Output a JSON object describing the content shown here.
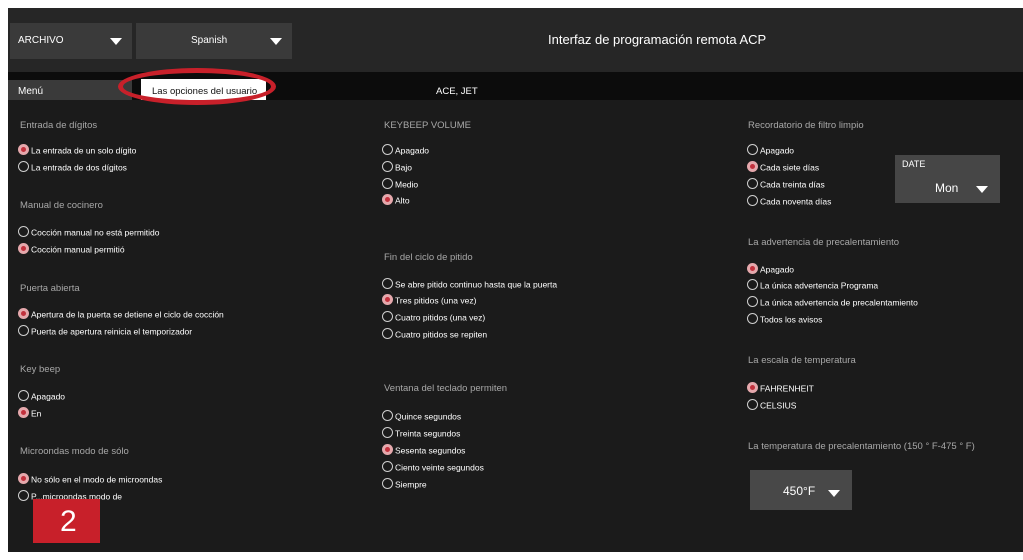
{
  "header": {
    "file_menu": "ARCHIVO",
    "language": "Spanish",
    "title": "Interfaz de programación remota ACP"
  },
  "tabs": {
    "menu": "Menú",
    "user_options": "Las opciones del usuario",
    "models": "ACE, JET"
  },
  "left": {
    "digit_entry": {
      "title": "Entrada de dígitos",
      "options": [
        "La entrada de un solo dígito",
        "La entrada de dos dígitos"
      ]
    },
    "manual_cook": {
      "title": "Manual de cocinero",
      "options": [
        "Cocción manual no está permitido",
        "Cocción manual permitió"
      ]
    },
    "door_open": {
      "title": "Puerta abierta",
      "options": [
        "Apertura de la puerta se detiene el ciclo de cocción",
        "Puerta de apertura reinicia el temporizador"
      ]
    },
    "key_beep": {
      "title": "Key beep",
      "options": [
        "Apagado",
        "En"
      ]
    },
    "micro_only": {
      "title": "Microondas modo de sólo",
      "options": [
        "No sólo en el modo de microondas",
        "P...microondas modo de"
      ]
    }
  },
  "middle": {
    "keybeep_volume": {
      "title": "KEYBEEP VOLUME",
      "options": [
        "Apagado",
        "Bajo",
        "Medio",
        "Alto"
      ]
    },
    "end_cycle": {
      "title": "Fin del ciclo de pitido",
      "options": [
        "Se abre pitido continuo hasta que la puerta",
        "Tres pitidos (una vez)",
        "Cuatro pitidos (una vez)",
        "Cuatro pitidos se repiten"
      ]
    },
    "keypad_window": {
      "title": "Ventana del teclado permiten",
      "options": [
        "Quince segundos",
        "Treinta segundos",
        "Sesenta segundos",
        "Ciento veinte segundos",
        "Siempre"
      ]
    }
  },
  "right": {
    "filter_reminder": {
      "title": "Recordatorio de filtro limpio",
      "options": [
        "Apagado",
        "Cada siete días",
        "Cada treinta días",
        "Cada noventa días"
      ]
    },
    "date": {
      "label": "DATE",
      "value": "Mon"
    },
    "preheat_warning": {
      "title": "La advertencia de precalentamiento",
      "options": [
        "Apagado",
        "La única advertencia Programa",
        "La única advertencia de precalentamiento",
        "Todos los avisos"
      ]
    },
    "temp_scale": {
      "title": "La escala de temperatura",
      "options": [
        "FAHRENHEIT",
        "CELSIUS"
      ]
    },
    "preheat_temp": {
      "title": "La temperatura de precalentamiento (150 ° F-475 ° F)",
      "value": "450°F"
    }
  },
  "badge": "2",
  "colors": {
    "background": "#1b1b1b",
    "header": "#262626",
    "highlight": "#c8202a",
    "radio_selected": "#c2303c"
  }
}
